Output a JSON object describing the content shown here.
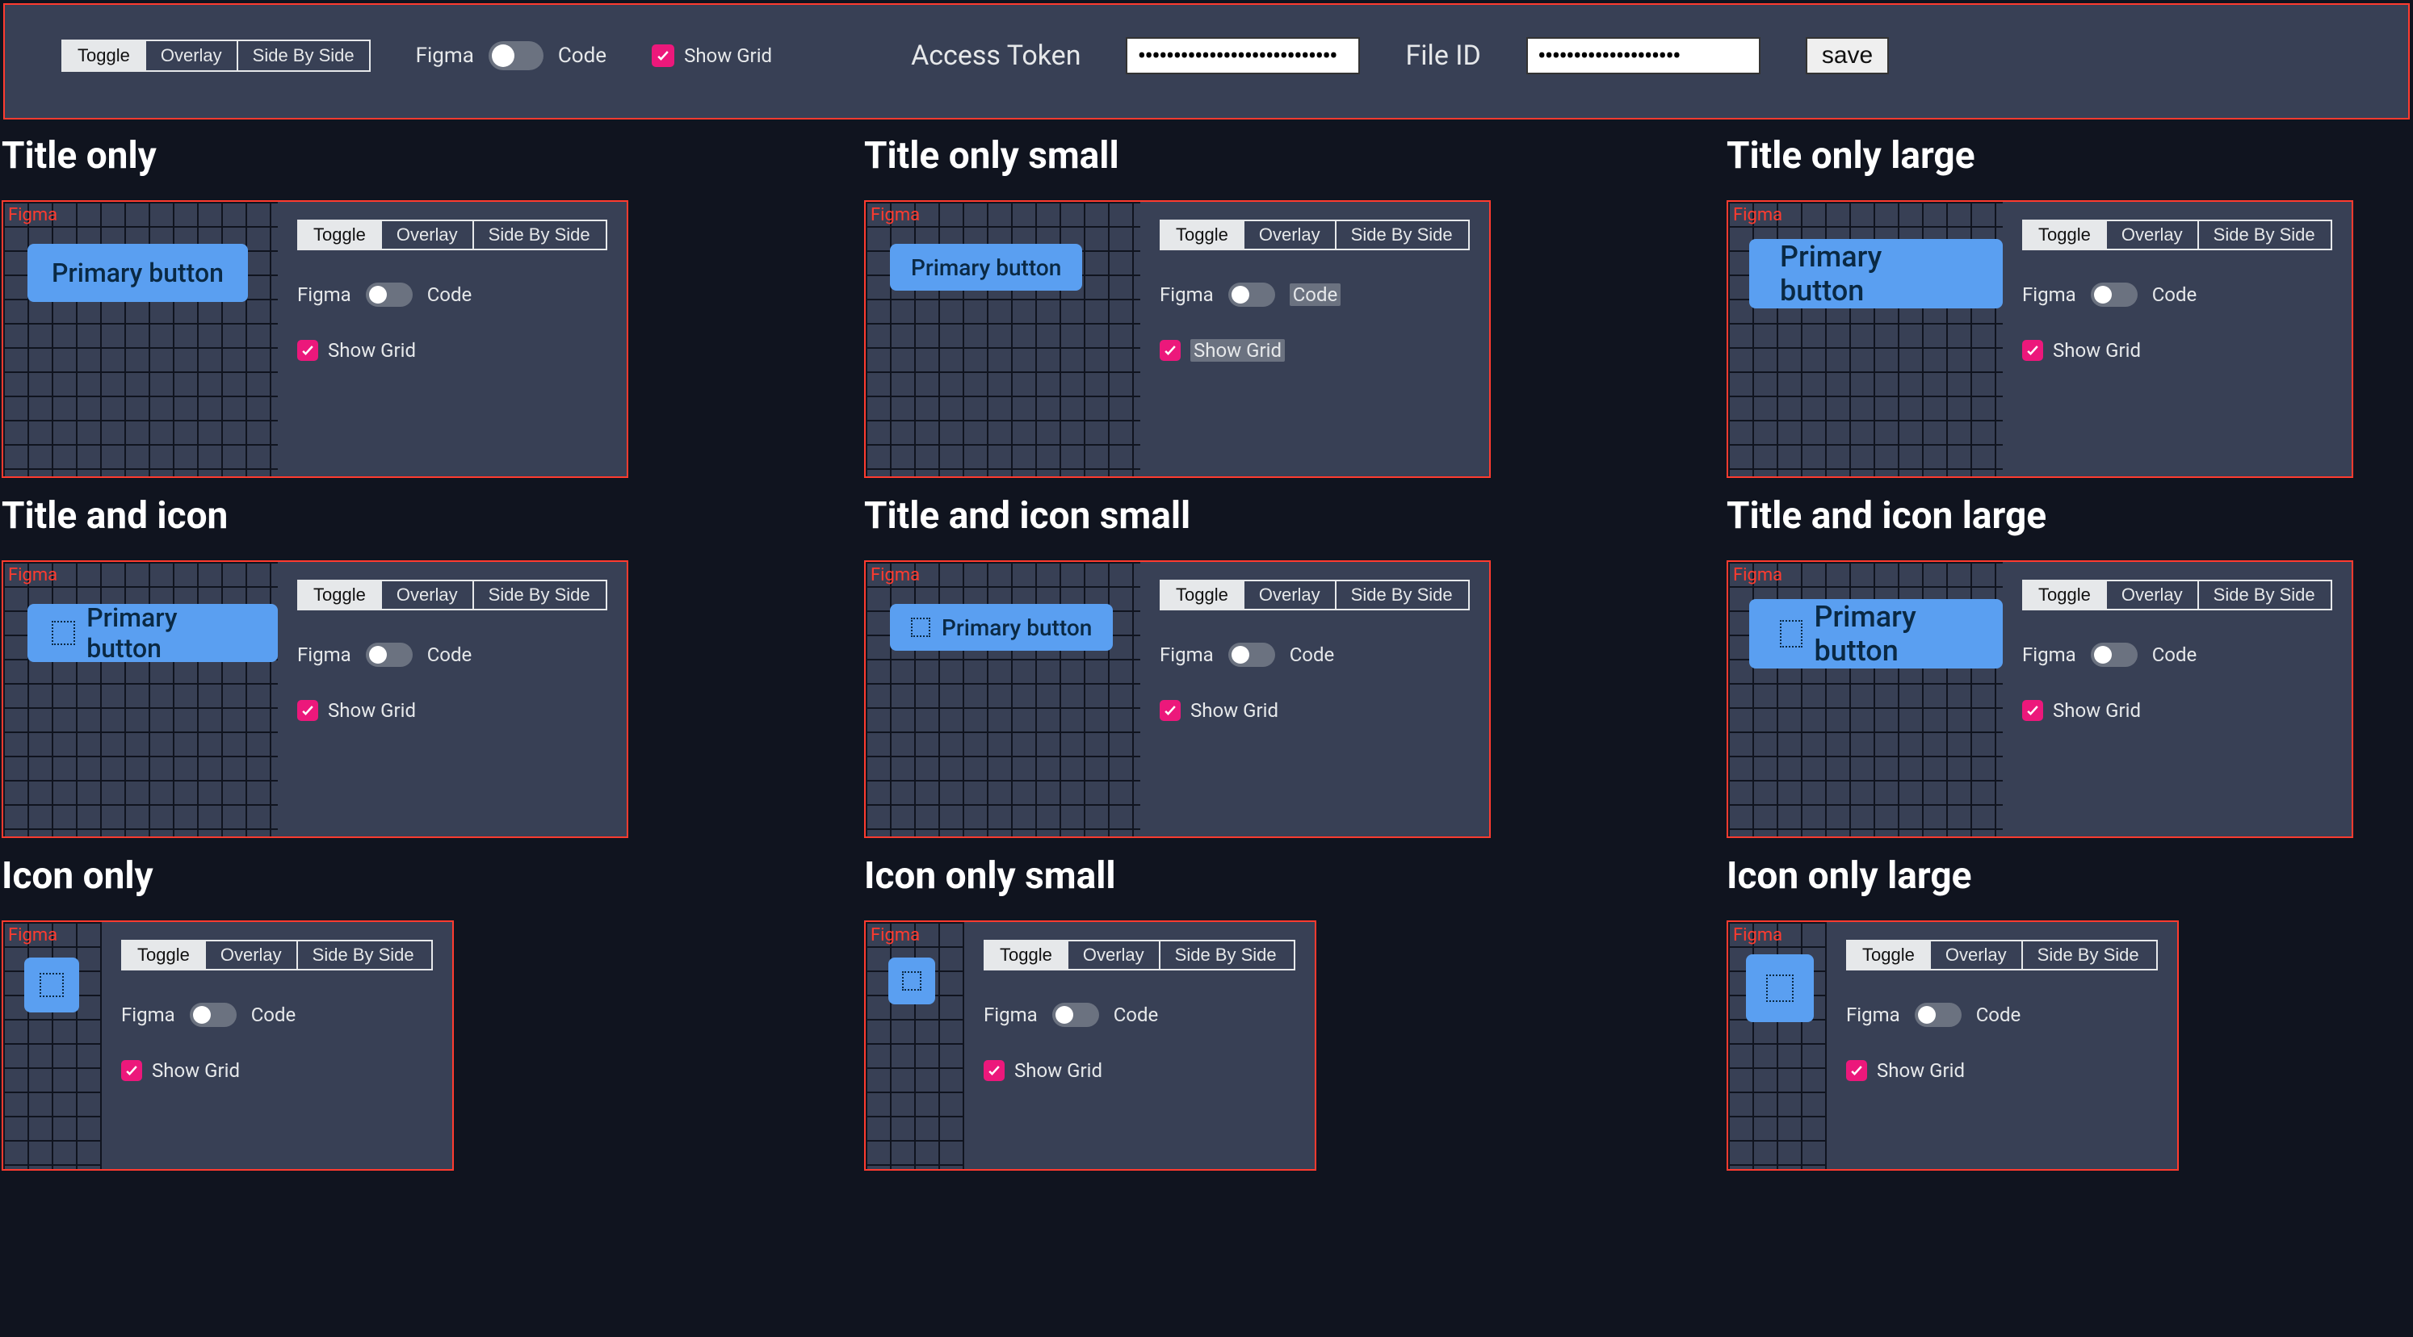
{
  "seg_labels": {
    "toggle": "Toggle",
    "overlay": "Overlay",
    "sbs": "Side By Side"
  },
  "switch_labels": {
    "figma": "Figma",
    "code": "Code"
  },
  "show_grid_label": "Show Grid",
  "top": {
    "access_token_label": "Access Token",
    "file_id_label": "File ID",
    "access_token_value": "••••••••••••••••••••••••••••",
    "file_id_value": "••••••••••••••••••••",
    "save_label": "save"
  },
  "preview": {
    "figma_tag": "Figma",
    "button_label": "Primary button"
  },
  "items": [
    {
      "title": "Title only",
      "kind": "title",
      "size": "md",
      "highlight": false
    },
    {
      "title": "Title only small",
      "kind": "title",
      "size": "sm",
      "highlight": true
    },
    {
      "title": "Title only large",
      "kind": "title",
      "size": "lg",
      "highlight": false
    },
    {
      "title": "Title and icon",
      "kind": "title-icon",
      "size": "md",
      "highlight": false
    },
    {
      "title": "Title and icon small",
      "kind": "title-icon",
      "size": "sm",
      "highlight": false
    },
    {
      "title": "Title and icon large",
      "kind": "title-icon",
      "size": "lg",
      "highlight": false
    },
    {
      "title": "Icon only",
      "kind": "icon",
      "size": "md",
      "highlight": false
    },
    {
      "title": "Icon only small",
      "kind": "icon",
      "size": "sm",
      "highlight": false
    },
    {
      "title": "Icon only large",
      "kind": "icon",
      "size": "lg",
      "highlight": false
    }
  ]
}
